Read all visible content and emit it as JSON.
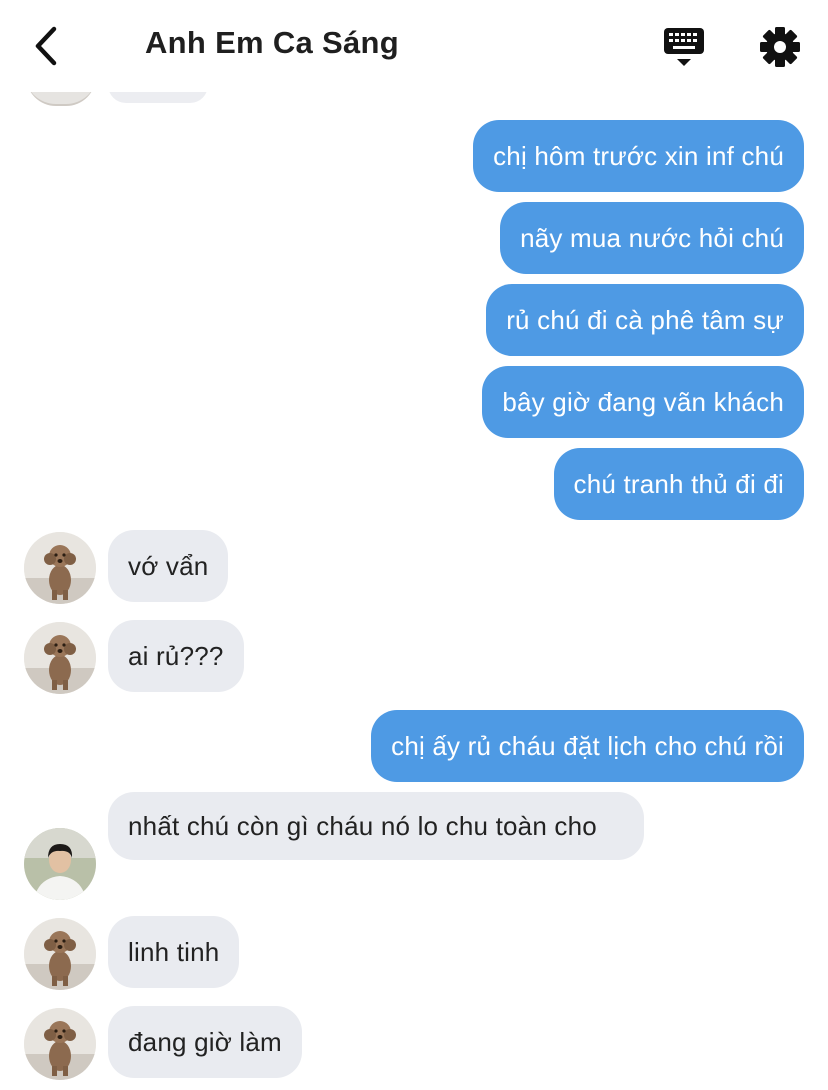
{
  "header": {
    "back_label": "back",
    "title": "Anh Em Ca Sáng",
    "keyboard_icon": "keyboard-icon",
    "settings_icon": "gear-icon"
  },
  "colors": {
    "outgoing_bubble": "#4e9ae4",
    "incoming_bubble": "#e9ebf0",
    "title_text": "#1f1f1f"
  },
  "messages": [
    {
      "side": "out",
      "text": "chị hôm trước xin inf chú"
    },
    {
      "side": "out",
      "text": "nãy mua nước hỏi chú"
    },
    {
      "side": "out",
      "text": "rủ chú đi cà phê tâm sự"
    },
    {
      "side": "out",
      "text": "bây giờ đang vãn khách"
    },
    {
      "side": "out",
      "text": "chú tranh thủ đi đi"
    },
    {
      "side": "in",
      "avatar": "dog-avatar",
      "text": "vớ vẩn"
    },
    {
      "side": "in",
      "avatar": "dog-avatar",
      "text": "ai rủ???"
    },
    {
      "side": "out",
      "text": "chị ấy rủ cháu đặt lịch cho chú rồi"
    },
    {
      "side": "in",
      "avatar": "person-avatar",
      "text": "nhất chú còn gì cháu nó lo chu toàn cho"
    },
    {
      "side": "in",
      "avatar": "dog-avatar",
      "text": "linh tinh"
    },
    {
      "side": "in",
      "avatar": "dog-avatar",
      "text": "đang giờ làm"
    }
  ]
}
